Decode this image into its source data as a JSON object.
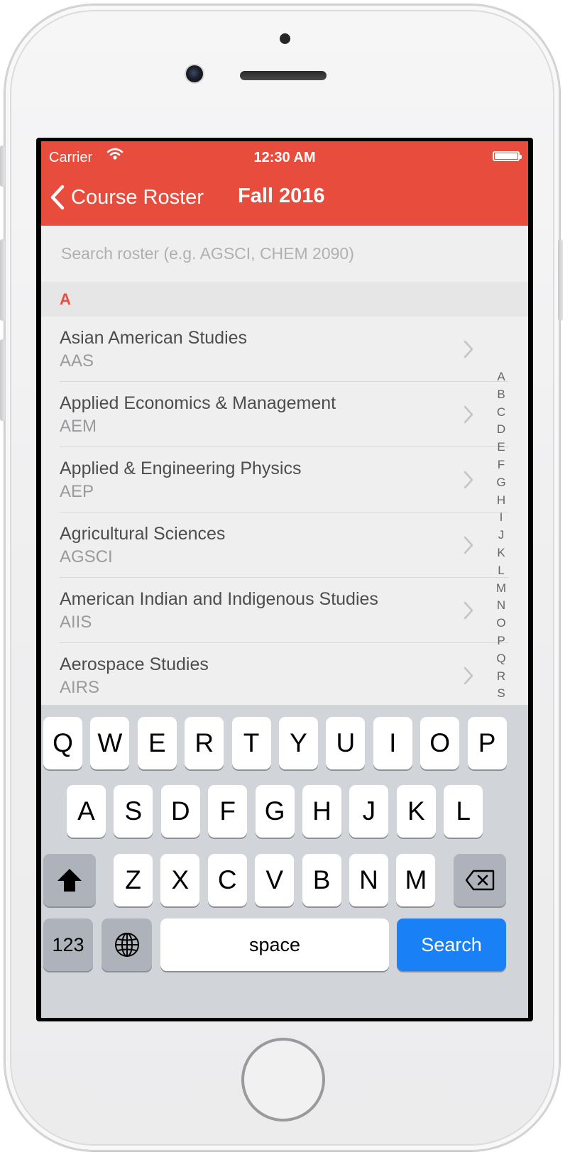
{
  "status_bar": {
    "carrier": "Carrier",
    "time": "12:30 AM"
  },
  "navbar": {
    "back_label": "Course Roster",
    "title": "Fall 2016",
    "color": "#e74c3c"
  },
  "search": {
    "placeholder": "Search roster (e.g. AGSCI, CHEM 2090)",
    "value": ""
  },
  "section": {
    "letter": "A"
  },
  "subjects": [
    {
      "name": "Asian American Studies",
      "code": "AAS"
    },
    {
      "name": "Applied Economics & Management",
      "code": "AEM"
    },
    {
      "name": "Applied & Engineering Physics",
      "code": "AEP"
    },
    {
      "name": "Agricultural Sciences",
      "code": "AGSCI"
    },
    {
      "name": "American Indian and Indigenous Studies",
      "code": "AIIS"
    },
    {
      "name": "Aerospace Studies",
      "code": "AIRS"
    }
  ],
  "index_letters": [
    "A",
    "B",
    "C",
    "D",
    "E",
    "F",
    "G",
    "H",
    "I",
    "J",
    "K",
    "L",
    "M",
    "N",
    "O",
    "P",
    "Q",
    "R",
    "S"
  ],
  "keyboard": {
    "row1": [
      "Q",
      "W",
      "E",
      "R",
      "T",
      "Y",
      "U",
      "I",
      "O",
      "P"
    ],
    "row2": [
      "A",
      "S",
      "D",
      "F",
      "G",
      "H",
      "J",
      "K",
      "L"
    ],
    "row3": [
      "Z",
      "X",
      "C",
      "V",
      "B",
      "N",
      "M"
    ],
    "numbers_label": "123",
    "space_label": "space",
    "search_label": "Search",
    "search_color": "#1a80f6"
  }
}
